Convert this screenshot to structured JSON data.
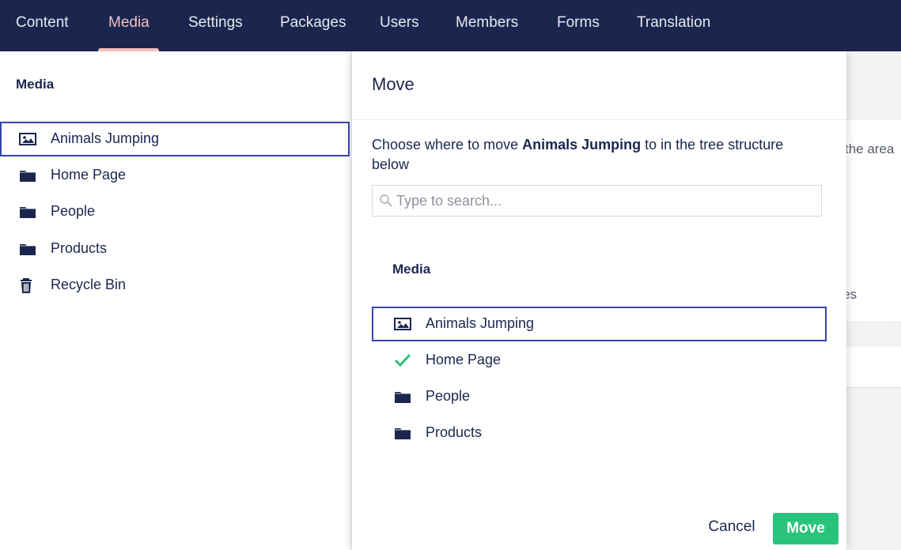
{
  "topnav": {
    "items": [
      {
        "label": "Content"
      },
      {
        "label": "Media"
      },
      {
        "label": "Settings"
      },
      {
        "label": "Packages"
      },
      {
        "label": "Users"
      },
      {
        "label": "Members"
      },
      {
        "label": "Forms"
      },
      {
        "label": "Translation"
      }
    ],
    "active": "Media"
  },
  "sidebar": {
    "title": "Media",
    "items": [
      {
        "label": "Animals Jumping",
        "icon": "image-icon",
        "selected": true
      },
      {
        "label": "Home Page",
        "icon": "folder-icon"
      },
      {
        "label": "People",
        "icon": "folder-icon"
      },
      {
        "label": "Products",
        "icon": "folder-icon"
      },
      {
        "label": "Recycle Bin",
        "icon": "trash-icon"
      }
    ]
  },
  "background": {
    "text_1": "the area",
    "text_2": "ules"
  },
  "dialog": {
    "title": "Move",
    "instruction_prefix": "Choose where to move ",
    "instruction_item": "Animals Jumping",
    "instruction_suffix": " to in the tree structure below",
    "search": {
      "placeholder": "Type to search..."
    },
    "tree": {
      "title": "Media",
      "items": [
        {
          "label": "Animals Jumping",
          "icon": "image-icon",
          "selected": true
        },
        {
          "label": "Home Page",
          "icon": "check-icon"
        },
        {
          "label": "People",
          "icon": "folder-icon"
        },
        {
          "label": "Products",
          "icon": "folder-icon"
        }
      ]
    },
    "cancel_label": "Cancel",
    "move_label": "Move"
  },
  "colors": {
    "header_bg": "#1b264f",
    "active_tab": "#f5c1bc",
    "selection_border": "#3544b1",
    "success_green": "#2bc37c",
    "text": "#1b264f"
  }
}
